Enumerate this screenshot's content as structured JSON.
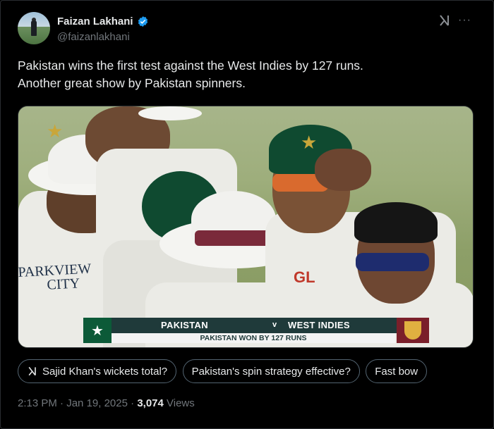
{
  "author": {
    "display_name": "Faizan Lakhani",
    "handle": "@faizanlakhani",
    "verified": true
  },
  "post": {
    "text_line1": "Pakistan wins the first test against the West Indies by 127 runs.",
    "text_line2": "Another great show by Pakistan spinners."
  },
  "media": {
    "scorebar": {
      "team_left": "PAKISTAN",
      "vs": "v",
      "team_right": "WEST INDIES",
      "result": "PAKISTAN WON BY 127 RUNS"
    },
    "banner_line1": "PARKVIEW",
    "banner_line2": "CITY"
  },
  "chips": [
    {
      "label": "Sajid Khan's wickets total?",
      "icon": "grok-icon"
    },
    {
      "label": "Pakistan's spin strategy effective?"
    },
    {
      "label": "Fast bow"
    }
  ],
  "meta": {
    "time": "2:13 PM",
    "sep1": " · ",
    "date": "Jan 19, 2025",
    "sep2": " · ",
    "views_count": "3,074",
    "views_label": " Views"
  },
  "colors": {
    "background": "#000000",
    "text_primary": "#e7e9ea",
    "text_secondary": "#71767b",
    "verified_blue": "#1d9bf0",
    "border": "#2f3336"
  }
}
